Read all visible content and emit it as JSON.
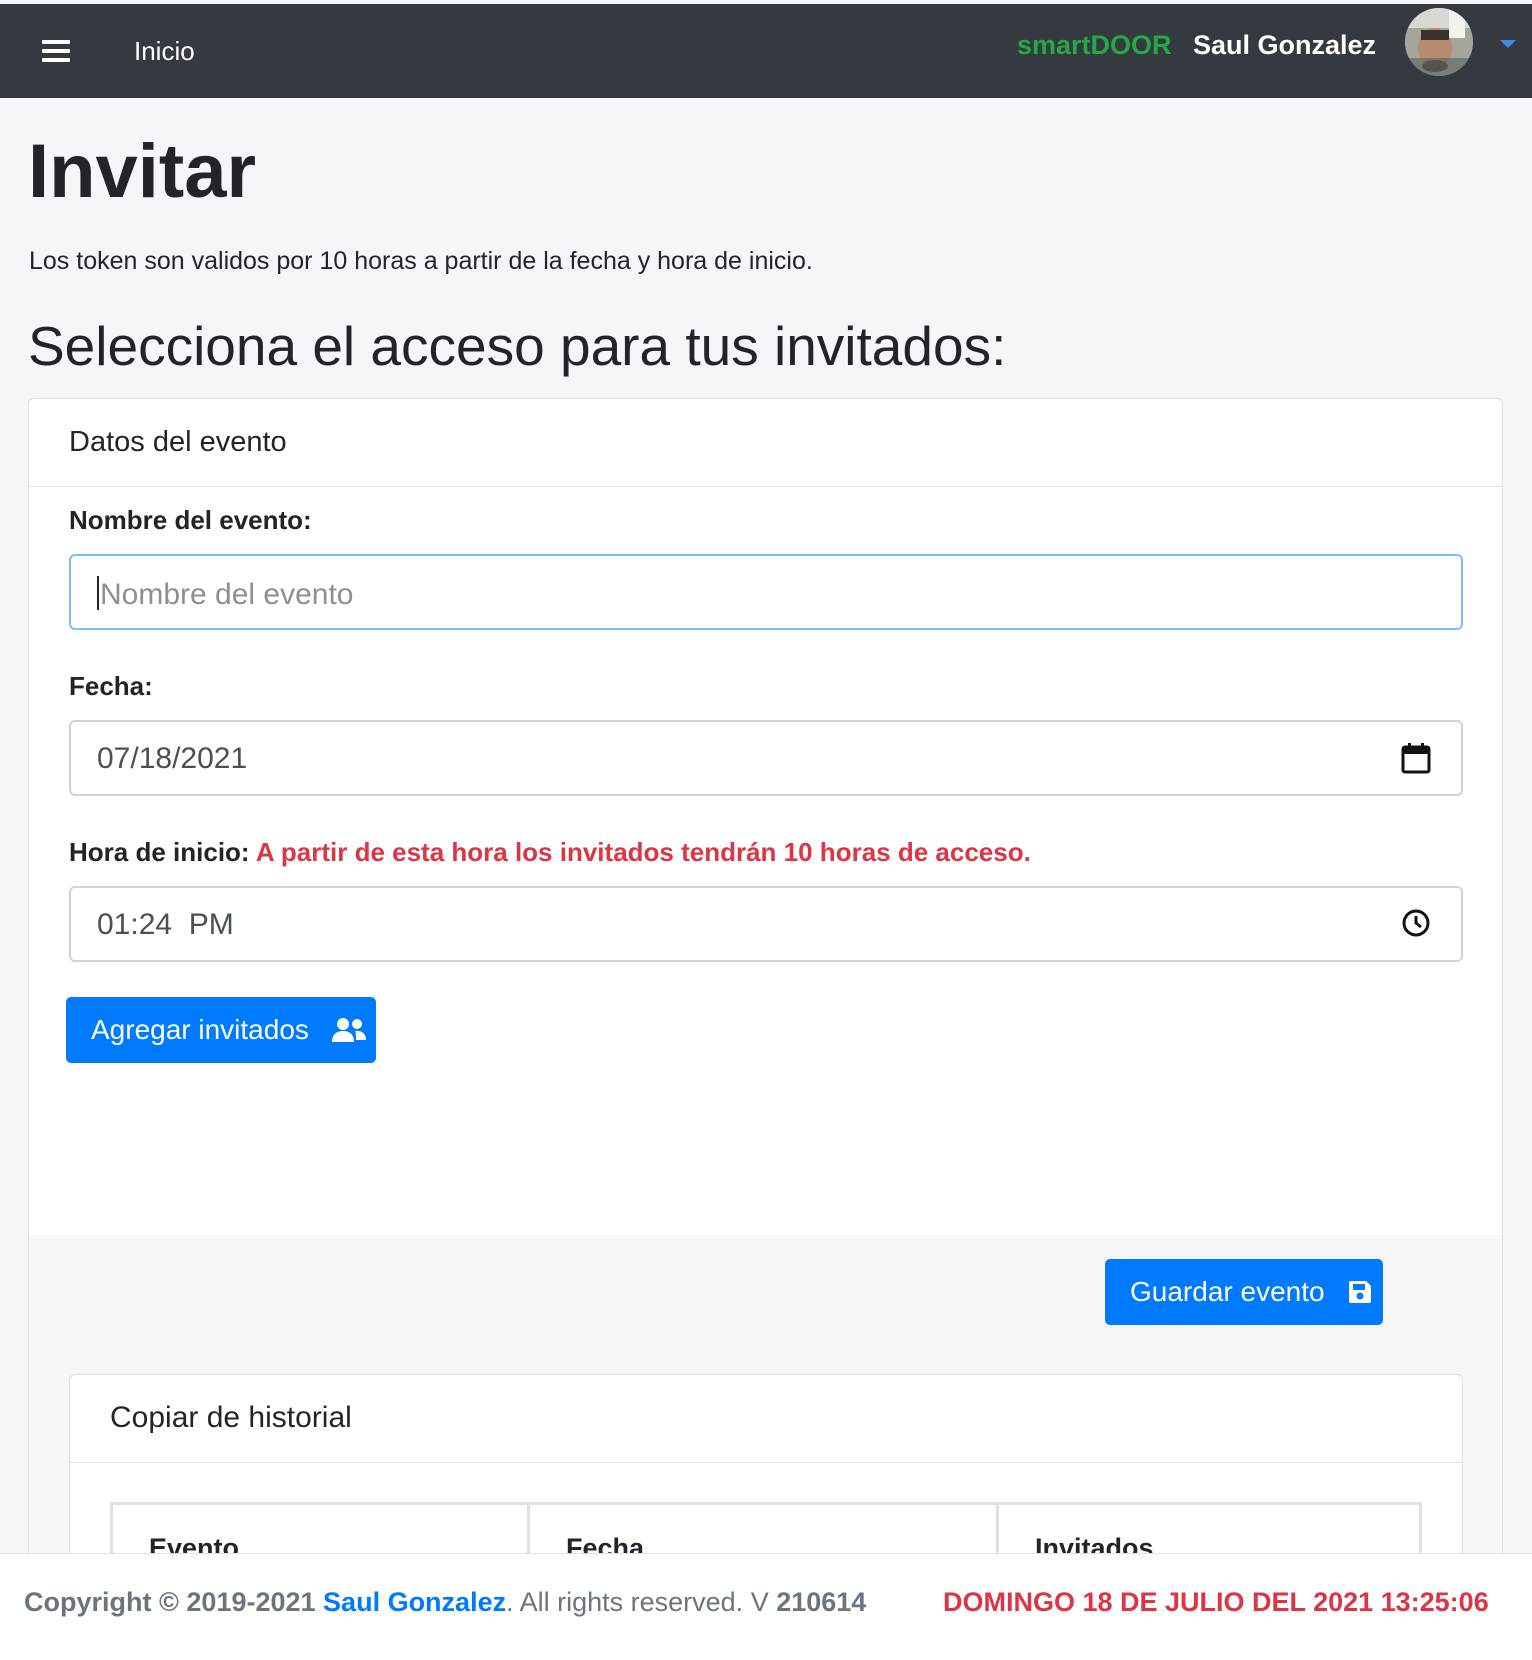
{
  "navbar": {
    "menu_icon": "bars-icon",
    "home_label": "Inicio",
    "brand": "smartDOOR",
    "user_name": "Saul Gonzalez",
    "dropdown_icon": "caret-down-icon",
    "brand_color": "#28a745"
  },
  "page": {
    "title": "Invitar",
    "subtitle": "Los token son validos por 10 horas a partir de la fecha y hora de inicio.",
    "heading": "Selecciona el acceso para tus invitados:"
  },
  "event_card": {
    "header": "Datos del evento",
    "name_label": "Nombre del evento:",
    "name_placeholder": "Nombre del evento",
    "name_value": "",
    "date_label": "Fecha:",
    "date_value": "07/18/2021",
    "date_icon": "calendar-icon",
    "time_label": "Hora de inicio:",
    "time_warning": "A partir de esta hora los invitados tendrán 10 horas de acceso.",
    "time_value": "01:24  PM",
    "time_icon": "clock-icon",
    "add_guests_label": "Agregar invitados",
    "add_guests_icon": "users-icon",
    "save_label": "Guardar evento",
    "save_icon": "save-icon"
  },
  "history_card": {
    "header": "Copiar de historial",
    "columns": [
      "Evento",
      "Fecha",
      "Invitados"
    ]
  },
  "footer": {
    "copyright_prefix": "Copyright ©",
    "years": "2019-2021",
    "author": "Saul Gonzalez",
    "reserved": ". All rights reserved. V",
    "version": "210614",
    "datetime": "DOMINGO 18 DE JULIO DEL 2021 13:25:06"
  },
  "colors": {
    "primary": "#007bff",
    "danger": "#dc3545",
    "navbar_bg": "#343a40"
  }
}
